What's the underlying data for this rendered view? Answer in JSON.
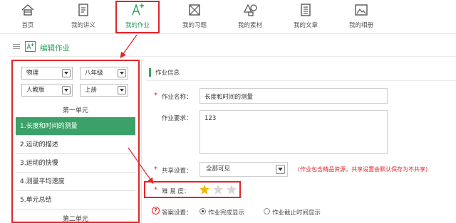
{
  "nav": {
    "items": [
      {
        "label": "首页",
        "icon": "home-icon",
        "active": false
      },
      {
        "label": "我的讲义",
        "icon": "document-icon",
        "active": false
      },
      {
        "label": "我的作业",
        "icon": "homework-icon",
        "active": true
      },
      {
        "label": "我的习题",
        "icon": "exercise-icon",
        "active": false
      },
      {
        "label": "我的素材",
        "icon": "material-icon",
        "active": false
      },
      {
        "label": "我的文章",
        "icon": "article-icon",
        "active": false
      },
      {
        "label": "我的相册",
        "icon": "album-icon",
        "active": false
      }
    ]
  },
  "page_title": "编辑作业",
  "filters": {
    "subject": "物理",
    "grade": "八年级",
    "edition": "人教版",
    "volume": "上册"
  },
  "units": [
    {
      "title": "第一单元",
      "lessons": [
        "1.长度和时间的测量",
        "2.运动的描述",
        "3.运动的快慢",
        "4.测量平均速度",
        "5.单元总结"
      ]
    },
    {
      "title": "第二单元",
      "lessons": []
    }
  ],
  "active_lesson": "1.长度和时间的测量",
  "form": {
    "section_title": "作业信息",
    "required_mark": "*",
    "name_label": "作业名称：",
    "name_value": "长度和时间的测量",
    "requirement_label": "作业要求：",
    "requirement_value": "123",
    "share_label": "共享设置：",
    "share_value": "全部可见",
    "share_note": "(作业包含精品资源，共享设置会默认保存为不共享)",
    "difficulty_label": "难 易 度：",
    "difficulty_rating": 1,
    "difficulty_max": 3,
    "answer_label": "答案设置：",
    "answer_options": [
      "作业完成显示",
      "作业截止时间显示"
    ],
    "answer_selected": 0
  },
  "colors": {
    "accent_green": "#3aa268",
    "highlight_red": "#e0262b",
    "star_gold": "#f2b705",
    "star_gray": "#d6d6d6"
  }
}
